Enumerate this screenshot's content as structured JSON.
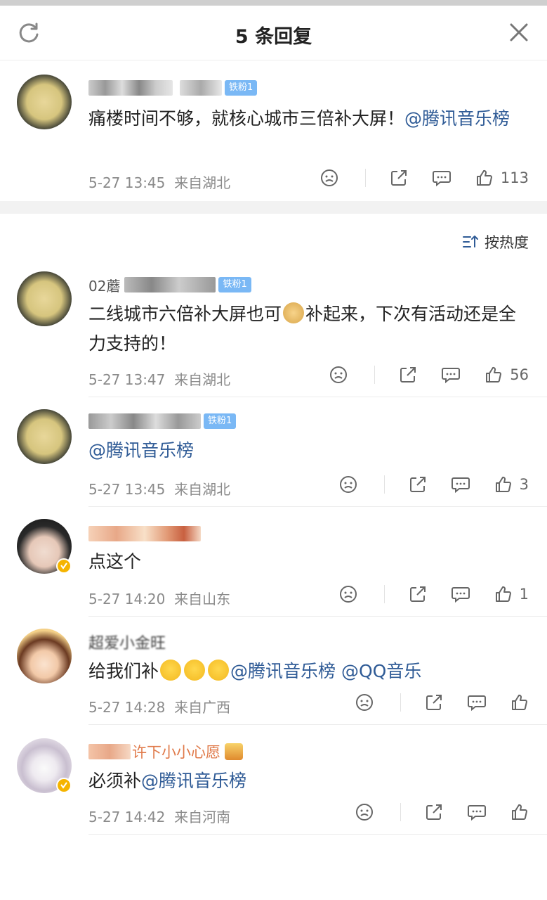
{
  "header": {
    "title": "5 条回复",
    "refresh_icon": "refresh-icon",
    "close_icon": "close-icon"
  },
  "sort": {
    "label": "按热度",
    "icon": "sort-icon"
  },
  "main_comment": {
    "badge": "铁粉1",
    "text": "痛楼时间不够，就核心城市三倍补大屏！",
    "mention": "@腾讯音乐榜",
    "time": "5-27 13:45",
    "location": "来自湖北",
    "likes": "113"
  },
  "replies": [
    {
      "name_fragment": "02蘑",
      "badge": "铁粉1",
      "text_a": "二线城市六倍补大屏也可",
      "text_b": "补起来，下次有活动还是全力支持的！",
      "time": "5-27 13:47",
      "location": "来自湖北",
      "likes": "56"
    },
    {
      "badge": "铁粉1",
      "mention": "@腾讯音乐榜",
      "time": "5-27 13:45",
      "location": "来自湖北",
      "likes": "3"
    },
    {
      "text": "点这个",
      "time": "5-27 14:20",
      "location": "来自山东",
      "likes": "1"
    },
    {
      "name_fragment": "超爱小金旺",
      "text": "给我们补",
      "mention_1": "@腾讯音乐榜",
      "mention_2": "@QQ音乐",
      "time": "5-27 14:28",
      "location": "来自广西",
      "likes": ""
    },
    {
      "name_fragment": "许下小小心愿",
      "text": "必须补",
      "mention": "@腾讯音乐榜",
      "time": "5-27 14:42",
      "location": "来自河南",
      "likes": ""
    }
  ],
  "colors": {
    "mention": "#2f5b96",
    "meta": "#8a8a8a",
    "badge": "#7ab8f5",
    "verified": "#f5b400"
  }
}
